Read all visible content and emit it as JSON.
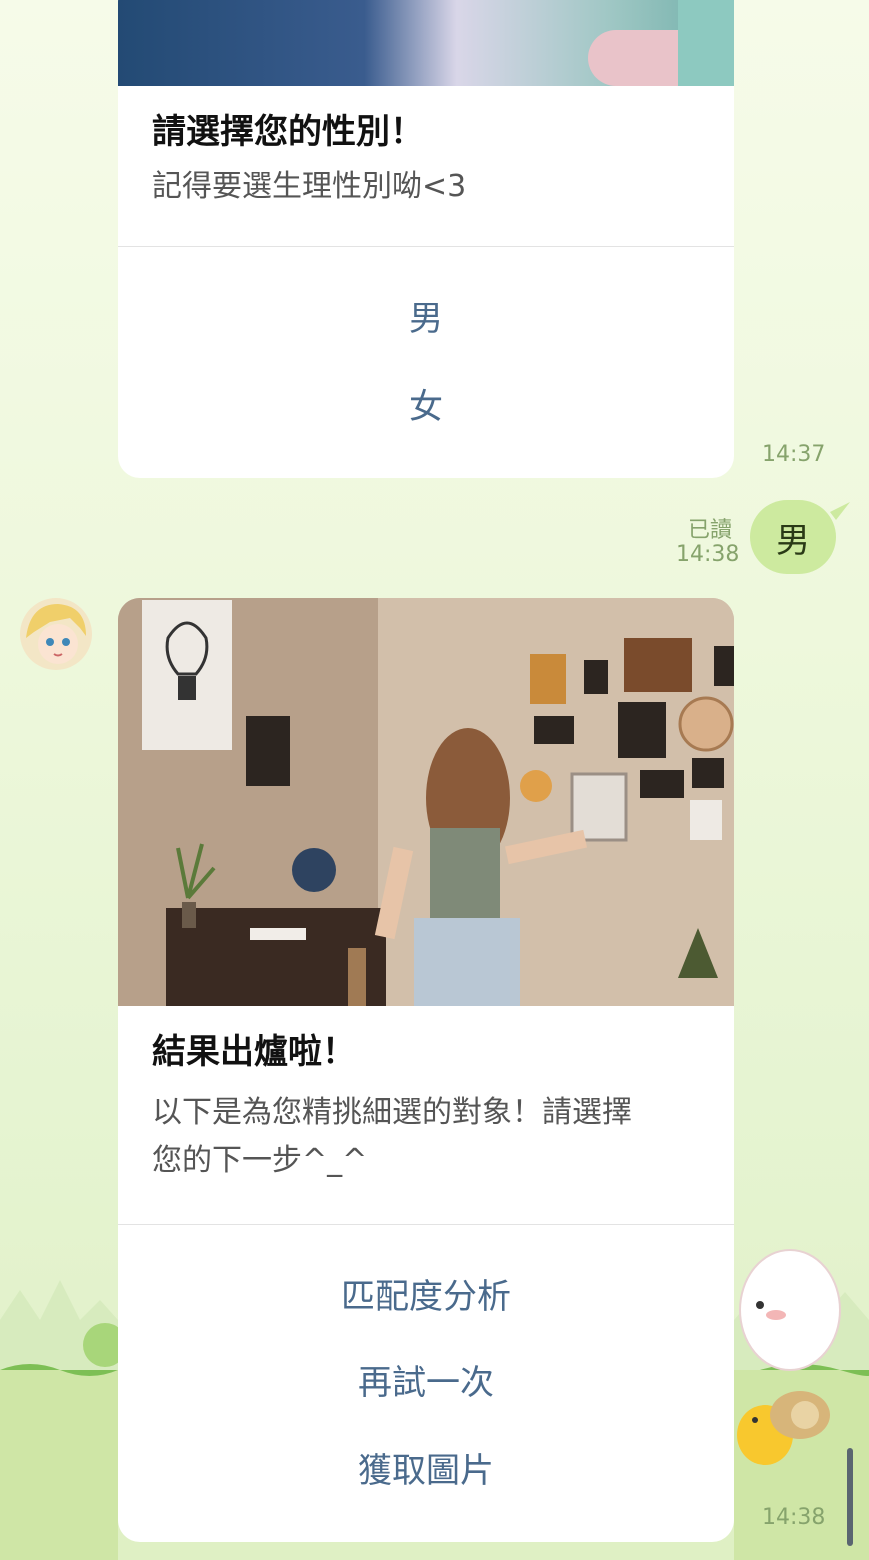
{
  "card1": {
    "title": "請選擇您的性別！",
    "desc": "記得要選生理性別呦<3",
    "actions": [
      "男",
      "女"
    ],
    "time": "14:37"
  },
  "user_reply": {
    "read_label": "已讀",
    "time": "14:38",
    "text": "男"
  },
  "card2": {
    "title": "結果出爐啦！",
    "desc_line1": "以下是為您精挑細選的對象！請選擇",
    "desc_line2": "您的下一步^_^",
    "actions": [
      "匹配度分析",
      "再試一次",
      "獲取圖片"
    ],
    "time": "14:38"
  },
  "icons": {
    "bot_avatar": "anime-avatar-icon",
    "scroll": "scrollbar"
  }
}
